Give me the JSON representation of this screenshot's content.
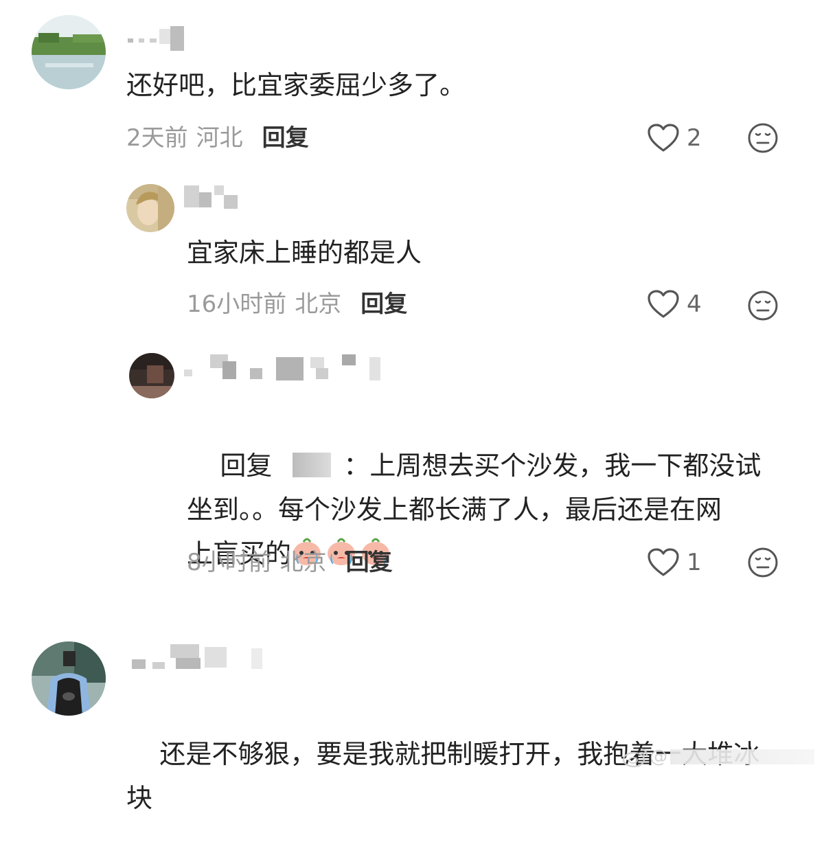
{
  "comments": [
    {
      "text": "还好吧，比宜家委屈少多了。",
      "time": "2天前",
      "location": "河北",
      "reply_label": "回复",
      "likes": "2"
    },
    {
      "text": "宜家床上睡的都是人",
      "time": "16小时前",
      "location": "北京",
      "reply_label": "回复",
      "likes": "4"
    },
    {
      "reply_prefix": "回复",
      "text_part1": "：上周想去买个沙发，我一下都没试",
      "text_part2": "坐到。。每个沙发上都长满了人，最后还是在网",
      "text_part3": "上盲买的",
      "time": "8小时前",
      "location": "北京",
      "reply_label": "回复",
      "likes": "1"
    },
    {
      "text_part1": "还是不够狠，要是我就把制暖打开，我抱着一大堆冰",
      "text_part2": "块"
    }
  ],
  "watermark": {
    "prefix": "@"
  },
  "icons": {
    "heart": "heart-outline-icon",
    "dislike": "neutral-face-icon",
    "emoji": "crying-peach-emoji",
    "weibo": "weibo-logo-icon"
  },
  "colors": {
    "meta_text": "#9a9a9a",
    "body_text": "#222222",
    "icon_stroke": "#555555"
  }
}
